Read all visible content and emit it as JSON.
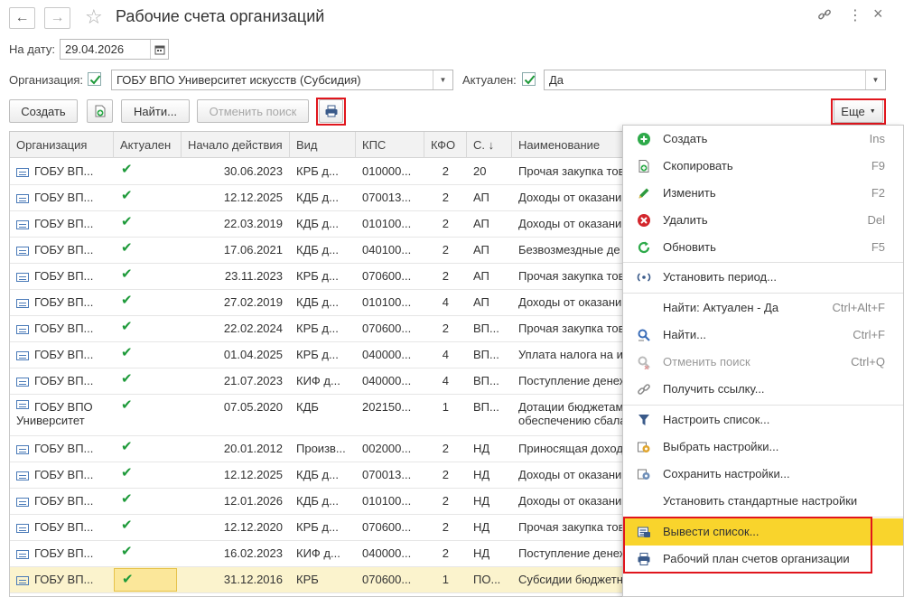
{
  "window": {
    "title": "Рабочие счета организаций",
    "back_icon": "←",
    "forward_icon": "→",
    "star_icon": "☆",
    "link_icon": "🔗",
    "more_icon": "⋮",
    "close_icon": "×"
  },
  "filters": {
    "date_label": "На дату:",
    "date_value": "29.04.2026",
    "org_label": "Организация:",
    "org_value": "ГОБУ ВПО Университет искусств (Субсидия)",
    "actual_label": "Актуален:",
    "actual_value": "Да"
  },
  "toolbar": {
    "create": "Создать",
    "find": "Найти...",
    "cancel_search": "Отменить поиск",
    "more": "Еще"
  },
  "table": {
    "columns": [
      "Организация",
      "Актуален",
      "Начало действия",
      "Вид",
      "КПС",
      "КФО",
      "С. ↓",
      "Наименование"
    ],
    "rows": [
      {
        "org": "ГОБУ ВП...",
        "actual": "✔",
        "start": "30.06.2023",
        "kind": "КРБ д...",
        "kps": "010000...",
        "kfo": "2",
        "s": "20",
        "name": "Прочая закупка тов"
      },
      {
        "org": "ГОБУ ВП...",
        "actual": "✔",
        "start": "12.12.2025",
        "kind": "КДБ д...",
        "kps": "070013...",
        "kfo": "2",
        "s": "АП",
        "name": "Доходы от оказани"
      },
      {
        "org": "ГОБУ ВП...",
        "actual": "✔",
        "start": "22.03.2019",
        "kind": "КДБ д...",
        "kps": "010100...",
        "kfo": "2",
        "s": "АП",
        "name": "Доходы от оказани"
      },
      {
        "org": "ГОБУ ВП...",
        "actual": "✔",
        "start": "17.06.2021",
        "kind": "КДБ д...",
        "kps": "040100...",
        "kfo": "2",
        "s": "АП",
        "name": "Безвозмездные де"
      },
      {
        "org": "ГОБУ ВП...",
        "actual": "✔",
        "start": "23.11.2023",
        "kind": "КРБ д...",
        "kps": "070600...",
        "kfo": "2",
        "s": "АП",
        "name": "Прочая закупка тов"
      },
      {
        "org": "ГОБУ ВП...",
        "actual": "✔",
        "start": "27.02.2019",
        "kind": "КДБ д...",
        "kps": "010100...",
        "kfo": "4",
        "s": "АП",
        "name": "Доходы от оказани"
      },
      {
        "org": "ГОБУ ВП...",
        "actual": "✔",
        "start": "22.02.2024",
        "kind": "КРБ д...",
        "kps": "070600...",
        "kfo": "2",
        "s": "ВП...",
        "name": "Прочая закупка тов"
      },
      {
        "org": "ГОБУ ВП...",
        "actual": "✔",
        "start": "01.04.2025",
        "kind": "КРБ д...",
        "kps": "040000...",
        "kfo": "4",
        "s": "ВП...",
        "name": "Уплата налога на и"
      },
      {
        "org": "ГОБУ ВП...",
        "actual": "✔",
        "start": "21.07.2023",
        "kind": "КИФ д...",
        "kps": "040000...",
        "kfo": "4",
        "s": "ВП...",
        "name": "Поступление денеж"
      },
      {
        "org": "ГОБУ ВПО Университет",
        "actual": "✔",
        "start": "07.05.2020",
        "kind": "КДБ",
        "kps": "202150...",
        "kfo": "1",
        "s": "ВП...",
        "name": "Дотации бюджетам обеспечению сбала"
      },
      {
        "org": "ГОБУ ВП...",
        "actual": "✔",
        "start": "20.01.2012",
        "kind": "Произв...",
        "kps": "002000...",
        "kfo": "2",
        "s": "НД",
        "name": "Приносящая доход"
      },
      {
        "org": "ГОБУ ВП...",
        "actual": "✔",
        "start": "12.12.2025",
        "kind": "КДБ д...",
        "kps": "070013...",
        "kfo": "2",
        "s": "НД",
        "name": "Доходы от оказани"
      },
      {
        "org": "ГОБУ ВП...",
        "actual": "✔",
        "start": "12.01.2026",
        "kind": "КДБ д...",
        "kps": "010100...",
        "kfo": "2",
        "s": "НД",
        "name": "Доходы от оказани"
      },
      {
        "org": "ГОБУ ВП...",
        "actual": "✔",
        "start": "12.12.2020",
        "kind": "КРБ д...",
        "kps": "070600...",
        "kfo": "2",
        "s": "НД",
        "name": "Прочая закупка тов"
      },
      {
        "org": "ГОБУ ВП...",
        "actual": "✔",
        "start": "16.02.2023",
        "kind": "КИФ д...",
        "kps": "040000...",
        "kfo": "2",
        "s": "НД",
        "name": "Поступление денеж"
      },
      {
        "org": "ГОБУ ВП...",
        "actual": "✔",
        "start": "31.12.2016",
        "kind": "КРБ",
        "kps": "070600...",
        "kfo": "1",
        "s": "ПО...",
        "name": "Субсидии бюджетным учреждениям на иные цели"
      }
    ]
  },
  "menu": {
    "items": [
      {
        "label": "Создать",
        "shortcut": "Ins",
        "icon": "plus-circle-icon"
      },
      {
        "label": "Скопировать",
        "shortcut": "F9",
        "icon": "copy-icon"
      },
      {
        "label": "Изменить",
        "shortcut": "F2",
        "icon": "pencil-icon"
      },
      {
        "label": "Удалить",
        "shortcut": "Del",
        "icon": "delete-icon"
      },
      {
        "label": "Обновить",
        "shortcut": "F5",
        "icon": "refresh-icon"
      },
      {
        "label": "Установить период...",
        "shortcut": "",
        "icon": "period-icon"
      },
      {
        "label": "Найти: Актуален - Да",
        "shortcut": "Ctrl+Alt+F",
        "icon": ""
      },
      {
        "label": "Найти...",
        "shortcut": "Ctrl+F",
        "icon": "search-icon"
      },
      {
        "label": "Отменить поиск",
        "shortcut": "Ctrl+Q",
        "icon": "cancel-search-icon"
      },
      {
        "label": "Получить ссылку...",
        "shortcut": "",
        "icon": "link-icon"
      },
      {
        "label": "Настроить список...",
        "shortcut": "",
        "icon": "filter-icon"
      },
      {
        "label": "Выбрать настройки...",
        "shortcut": "",
        "icon": "settings-open-icon"
      },
      {
        "label": "Сохранить настройки...",
        "shortcut": "",
        "icon": "settings-save-icon"
      },
      {
        "label": "Установить стандартные настройки",
        "shortcut": "",
        "icon": ""
      },
      {
        "label": "Вывести список...",
        "shortcut": "",
        "icon": "list-output-icon"
      },
      {
        "label": "Рабочий план счетов организации",
        "shortcut": "",
        "icon": "printer-icon"
      }
    ]
  },
  "colors": {
    "highlight_red": "#e0161d",
    "menu_selected": "#f9d42c",
    "row_selected": "#fbf3cd",
    "check_green": "#1e9a3a"
  }
}
